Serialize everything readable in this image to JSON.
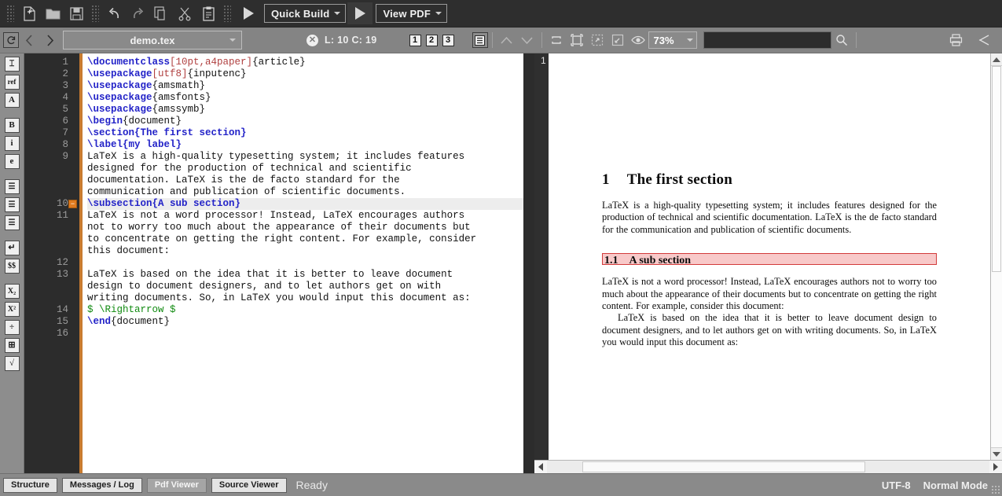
{
  "window": {
    "title": "demo.tex"
  },
  "toolbar_main": {
    "buttons": [
      {
        "name": "new-file-icon",
        "label": "New"
      },
      {
        "name": "open-file-icon",
        "label": "Open"
      },
      {
        "name": "save-file-icon",
        "label": "Save"
      },
      {
        "name": "undo-icon",
        "label": "Undo"
      },
      {
        "name": "redo-icon",
        "label": "Redo"
      },
      {
        "name": "copy-icon",
        "label": "Copy"
      },
      {
        "name": "cut-icon",
        "label": "Cut"
      },
      {
        "name": "paste-icon",
        "label": "Paste"
      }
    ],
    "build_run_label": "Quick Build",
    "view_run_label": "View PDF"
  },
  "toolbar_doc": {
    "reload_icon": "reload-icon",
    "back_label": "Back",
    "forward_label": "Forward",
    "file_name": "demo.tex",
    "error_clear_label": "✕",
    "cursor_position": "L: 10 C: 19",
    "view_modes": [
      "1",
      "2",
      "3"
    ]
  },
  "toolbar_pdf": {
    "toc_icon": "toc-icon",
    "prev_page_icon": "chevron-up-icon",
    "next_page_icon": "chevron-down-icon",
    "fit_width_icon": "fit-width-icon",
    "fit_page_icon": "fit-page-icon",
    "zoom_select_icon": "zoom-select-icon",
    "zoom_shrink_icon": "zoom-shrink-icon",
    "preview_eye_icon": "eye-icon",
    "zoom_level": "73%",
    "search_placeholder": "",
    "search_value": "",
    "search_icon": "search-icon",
    "print_icon": "print-icon",
    "detach_icon": "detach-icon"
  },
  "sidebar": {
    "items": [
      {
        "name": "insert-block-icon",
        "label": "⌶"
      },
      {
        "name": "reference-icon",
        "label": "ref"
      },
      {
        "name": "font-size-icon",
        "label": "A"
      },
      {
        "name": "bold-icon",
        "label": "B"
      },
      {
        "name": "italic-icon",
        "label": "i"
      },
      {
        "name": "emphasis-icon",
        "label": "e"
      },
      {
        "name": "align-left-icon",
        "label": "☰"
      },
      {
        "name": "align-center-icon",
        "label": "☰"
      },
      {
        "name": "align-right-icon",
        "label": "☰"
      },
      {
        "name": "newline-icon",
        "label": "↵"
      },
      {
        "name": "math-inline-icon",
        "label": "$$"
      },
      {
        "name": "subscript-icon",
        "label": "X₂"
      },
      {
        "name": "superscript-icon",
        "label": "X²"
      },
      {
        "name": "fraction-icon",
        "label": "÷"
      },
      {
        "name": "matrix-icon",
        "label": "⊞"
      },
      {
        "name": "sqrt-icon",
        "label": "√"
      }
    ]
  },
  "editor": {
    "line_numbers": [
      "1",
      "2",
      "3",
      "4",
      "5",
      "6",
      "7",
      "8",
      "9",
      "",
      "",
      "",
      "10",
      "11",
      "",
      "",
      "",
      "12",
      "13",
      "",
      "",
      "",
      "14",
      "15",
      "16"
    ],
    "highlighted_line": "10",
    "fold_marker": "−",
    "lines": [
      {
        "n": "1",
        "segments": [
          {
            "t": "\\documentclass",
            "c": "kw"
          },
          {
            "t": "[10pt,a4paper]",
            "c": "pkg"
          },
          {
            "t": "{article}",
            "c": "brace"
          }
        ]
      },
      {
        "n": "2",
        "segments": [
          {
            "t": "\\usepackage",
            "c": "kw"
          },
          {
            "t": "[utf8]",
            "c": "pkg"
          },
          {
            "t": "{inputenc}",
            "c": "brace"
          }
        ]
      },
      {
        "n": "3",
        "segments": [
          {
            "t": "\\usepackage",
            "c": "kw"
          },
          {
            "t": "{amsmath}",
            "c": "brace"
          }
        ]
      },
      {
        "n": "4",
        "segments": [
          {
            "t": "\\usepackage",
            "c": "kw"
          },
          {
            "t": "{amsfonts}",
            "c": "brace"
          }
        ]
      },
      {
        "n": "5",
        "segments": [
          {
            "t": "\\usepackage",
            "c": "kw"
          },
          {
            "t": "{amssymb}",
            "c": "brace"
          }
        ]
      },
      {
        "n": "6",
        "segments": [
          {
            "t": "\\begin",
            "c": "kw"
          },
          {
            "t": "{document}",
            "c": "brace"
          }
        ]
      },
      {
        "n": "7",
        "segments": [
          {
            "t": "\\section{The first section}",
            "c": "sect"
          }
        ]
      },
      {
        "n": "8",
        "segments": [
          {
            "t": "\\label{my label}",
            "c": "sect"
          }
        ]
      },
      {
        "n": "9",
        "segments": [
          {
            "t": "LaTeX is a high-quality typesetting system; it includes features",
            "c": "plain"
          }
        ]
      },
      {
        "n": "",
        "segments": [
          {
            "t": "designed for the production of technical and scientific",
            "c": "plain"
          }
        ]
      },
      {
        "n": "",
        "segments": [
          {
            "t": "documentation. LaTeX is the de facto standard for the",
            "c": "plain"
          }
        ]
      },
      {
        "n": "",
        "segments": [
          {
            "t": "communication and publication of scientific documents.",
            "c": "plain"
          }
        ]
      },
      {
        "n": "10",
        "segments": [
          {
            "t": "\\subsection{A sub section}",
            "c": "sect"
          }
        ],
        "highlight": true
      },
      {
        "n": "11",
        "segments": [
          {
            "t": "LaTeX is not a word processor! Instead, LaTeX encourages authors",
            "c": "plain"
          }
        ]
      },
      {
        "n": "",
        "segments": [
          {
            "t": "not to worry too much about the appearance of their documents but",
            "c": "plain"
          }
        ]
      },
      {
        "n": "",
        "segments": [
          {
            "t": "to concentrate on getting the right content. For example, consider",
            "c": "plain"
          }
        ]
      },
      {
        "n": "",
        "segments": [
          {
            "t": "this document:",
            "c": "plain"
          }
        ]
      },
      {
        "n": "12",
        "segments": [
          {
            "t": "",
            "c": "plain"
          }
        ]
      },
      {
        "n": "13",
        "segments": [
          {
            "t": "LaTeX is based on the idea that it is better to leave document",
            "c": "plain"
          }
        ]
      },
      {
        "n": "",
        "segments": [
          {
            "t": "design to document designers, and to let authors get on with",
            "c": "plain"
          }
        ]
      },
      {
        "n": "",
        "segments": [
          {
            "t": "writing documents. So, in LaTeX you would input this document as:",
            "c": "plain"
          }
        ]
      },
      {
        "n": "14",
        "segments": [
          {
            "t": "$ \\Rightarrow $",
            "c": "math"
          }
        ]
      },
      {
        "n": "15",
        "segments": [
          {
            "t": "\\end",
            "c": "kw"
          },
          {
            "t": "{document}",
            "c": "brace"
          }
        ]
      },
      {
        "n": "16",
        "segments": [
          {
            "t": "",
            "c": "plain"
          }
        ]
      }
    ]
  },
  "pdf": {
    "page_label": "1",
    "section_number": "1",
    "section_title": "The first section",
    "paragraph_1": "LaTeX is a high-quality typesetting system; it includes features designed for the production of technical and scientific documentation. LaTeX is the de facto standard for the communication and publication of scientific documents.",
    "subsection_number": "1.1",
    "subsection_title": "A sub section",
    "subsection_highlight_color": "#f8c9c9",
    "subsection_highlight_border": "#d23b3b",
    "paragraph_2": "LaTeX is not a word processor! Instead, LaTeX encourages authors not to worry too much about the appearance of their documents but to concentrate on getting the right content. For example, consider this document:",
    "paragraph_3": "LaTeX is based on the idea that it is better to leave document design to document designers, and to let authors get on with writing documents. So, in LaTeX you would input this document as:"
  },
  "statusbar": {
    "buttons": [
      {
        "name": "structure-button",
        "label": "Structure",
        "active": false
      },
      {
        "name": "messages-log-button",
        "label": "Messages / Log",
        "active": false
      },
      {
        "name": "pdf-viewer-button",
        "label": "Pdf Viewer",
        "active": true
      },
      {
        "name": "source-viewer-button",
        "label": "Source Viewer",
        "active": false
      }
    ],
    "status_text": "Ready",
    "encoding": "UTF-8",
    "mode": "Normal Mode"
  }
}
